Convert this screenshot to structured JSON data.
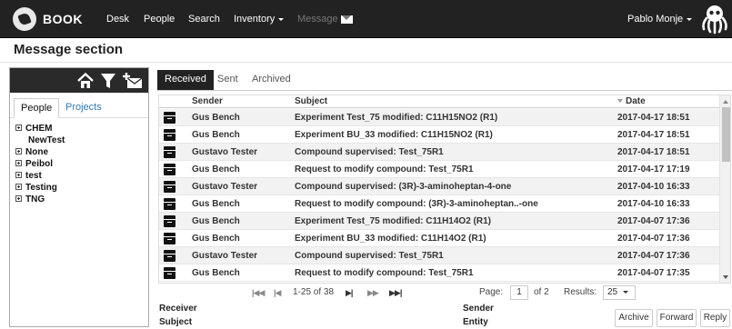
{
  "navbar": {
    "brand": "BOOK",
    "items": [
      {
        "label": "Desk"
      },
      {
        "label": "People"
      },
      {
        "label": "Search"
      },
      {
        "label": "Inventory"
      },
      {
        "label": "Message"
      }
    ],
    "user": "Pablo Monje"
  },
  "page_title": "Message section",
  "left_panel": {
    "tabs": [
      "People",
      "Projects"
    ],
    "active_tab": "People",
    "tree": [
      {
        "label": "CHEM",
        "expandable": true
      },
      {
        "label": "NewTest",
        "expandable": false
      },
      {
        "label": "None",
        "expandable": true
      },
      {
        "label": "Peibol",
        "expandable": true
      },
      {
        "label": "test",
        "expandable": true
      },
      {
        "label": "Testing",
        "expandable": true
      },
      {
        "label": "TNG",
        "expandable": true
      }
    ]
  },
  "right_panel": {
    "tabs": [
      "Received",
      "Sent",
      "Archived"
    ],
    "active_tab": "Received",
    "columns": {
      "sender": "Sender",
      "subject": "Subject",
      "date": "Date"
    },
    "rows": [
      {
        "sender": "Gus Bench",
        "subject": "Experiment Test_75 modified: C11H15NO2 (R1)",
        "date": "2017-04-17 18:51"
      },
      {
        "sender": "Gus Bench",
        "subject": "Experiment BU_33 modified: C11H15NO2 (R1)",
        "date": "2017-04-17 18:51"
      },
      {
        "sender": "Gustavo Tester",
        "subject": "Compound supervised: Test_75R1",
        "date": "2017-04-17 18:51"
      },
      {
        "sender": "Gus Bench",
        "subject": "Request to modify compound: Test_75R1",
        "date": "2017-04-17 17:19"
      },
      {
        "sender": "Gustavo Tester",
        "subject": "Compound supervised: (3R)-3-aminoheptan-4-one",
        "date": "2017-04-10 16:33"
      },
      {
        "sender": "Gus Bench",
        "subject": "Request to modify compound: (3R)-3-aminoheptan..-one",
        "date": "2017-04-10 16:33"
      },
      {
        "sender": "Gus Bench",
        "subject": "Experiment Test_75 modified: C11H14O2 (R1)",
        "date": "2017-04-07 17:36"
      },
      {
        "sender": "Gus Bench",
        "subject": "Experiment BU_33 modified: C11H14O2 (R1)",
        "date": "2017-04-07 17:36"
      },
      {
        "sender": "Gustavo Tester",
        "subject": "Compound supervised: Test_75R1",
        "date": "2017-04-07 17:36"
      },
      {
        "sender": "Gus Bench",
        "subject": "Request to modify compound: Test_75R1",
        "date": "2017-04-07 17:35"
      }
    ],
    "pager": {
      "range": "1-25 of 38",
      "page_label": "Page:",
      "page_value": "1",
      "of_label": "of 2",
      "results_label": "Results:",
      "results_value": "25"
    },
    "detail": {
      "receiver": "Receiver",
      "subject": "Subject",
      "sender": "Sender",
      "entity": "Entity"
    },
    "buttons": {
      "archive": "Archive",
      "forward": "Forward",
      "reply": "Reply"
    }
  },
  "icons": [
    "home-icon",
    "filter-icon",
    "new-message-icon",
    "archive-icon",
    "envelope-icon",
    "octopus-logo-icon"
  ]
}
